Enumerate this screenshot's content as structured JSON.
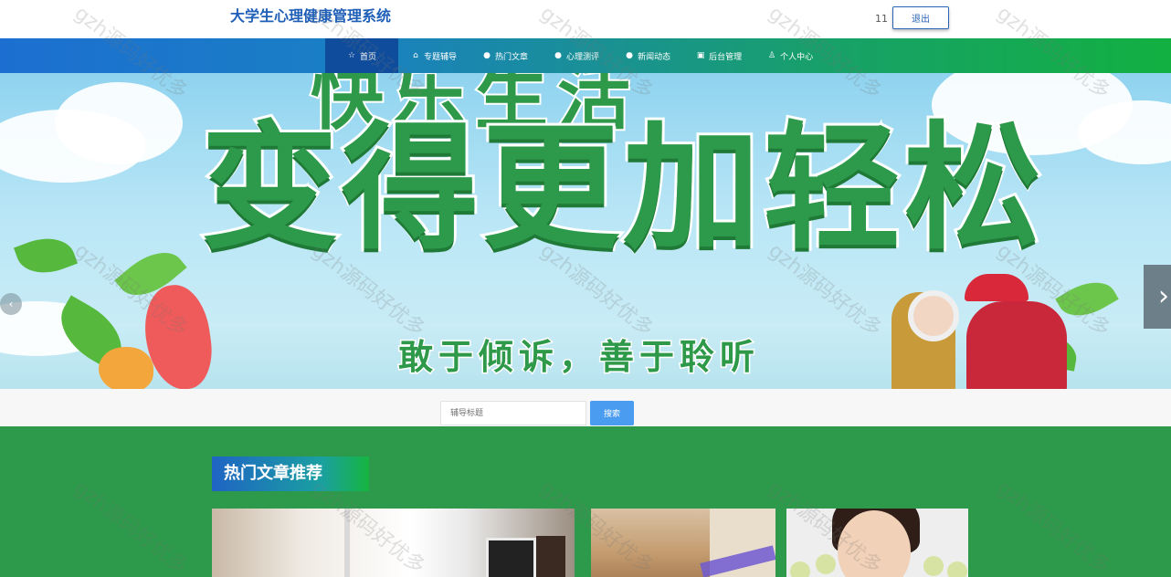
{
  "header": {
    "title": "大学生心理健康管理系统",
    "user_id": "11",
    "logout_label": "退出"
  },
  "nav": {
    "items": [
      {
        "label": "首页",
        "icon": "star-icon",
        "active": true
      },
      {
        "label": "专题辅导",
        "icon": "home-icon"
      },
      {
        "label": "热门文章",
        "icon": "info-icon"
      },
      {
        "label": "心理测评",
        "icon": "question-icon"
      },
      {
        "label": "新闻动态",
        "icon": "info-icon"
      },
      {
        "label": "后台管理",
        "icon": "briefcase-icon"
      },
      {
        "label": "个人中心",
        "icon": "user-icon"
      }
    ]
  },
  "banner": {
    "line_top": "快乐生活",
    "line_main": "变得更加轻松",
    "line_sub": "敢于倾诉，善于聆听",
    "slide_count": 3,
    "active_slide": 3
  },
  "search": {
    "placeholder": "辅导标题",
    "button_label": "搜索"
  },
  "hot": {
    "section_title": "热门文章推荐"
  },
  "watermark": "gzh源码好优多",
  "colors": {
    "brand_blue": "#1f5fb8",
    "nav_active": "#0f4d9c",
    "section_green": "#2c9a4a",
    "search_button": "#4a9cf0"
  }
}
